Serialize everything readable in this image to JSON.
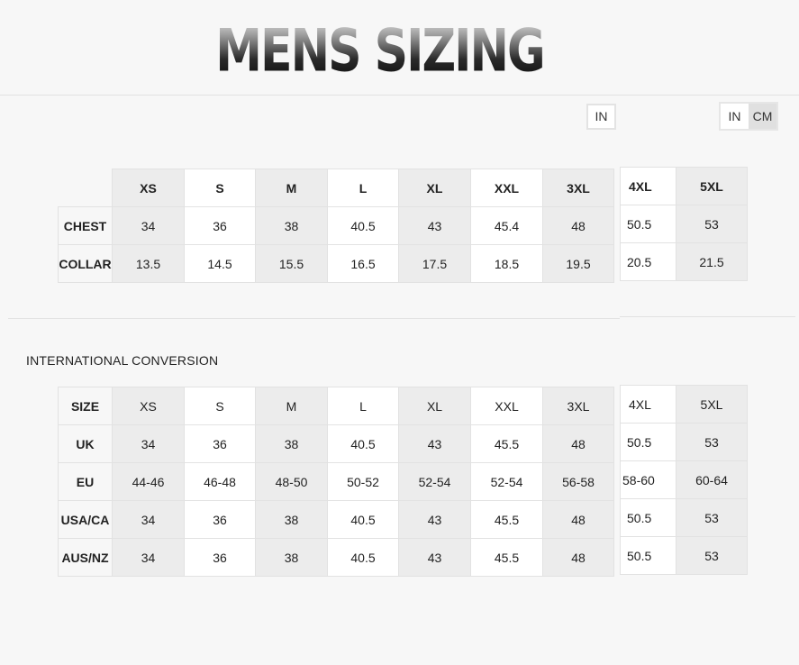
{
  "title": "MENS SIZING",
  "unit_toggle_single": "IN",
  "unit_toggle": {
    "in": "IN",
    "cm": "CM"
  },
  "section2_title": "INTERNATIONAL CONVERSION",
  "sizes_main": [
    "XS",
    "S",
    "M",
    "L",
    "XL",
    "XXL",
    "3XL"
  ],
  "sizes_extra": [
    "4XL",
    "5XL"
  ],
  "measurements": [
    {
      "label": "CHEST",
      "values": [
        "34",
        "36",
        "38",
        "40.5",
        "43",
        "45.4",
        "48"
      ],
      "extra": [
        "50.5",
        "53"
      ]
    },
    {
      "label": "COLLAR",
      "values": [
        "13.5",
        "14.5",
        "15.5",
        "16.5",
        "17.5",
        "18.5",
        "19.5"
      ],
      "extra": [
        "20.5",
        "21.5"
      ]
    }
  ],
  "conversion": {
    "header_label": "SIZE",
    "rows": [
      {
        "label": "UK",
        "values": [
          "34",
          "36",
          "38",
          "40.5",
          "43",
          "45.5",
          "48"
        ],
        "extra": [
          "50.5",
          "53"
        ]
      },
      {
        "label": "EU",
        "values": [
          "44-46",
          "46-48",
          "48-50",
          "50-52",
          "52-54",
          "52-54",
          "56-58"
        ],
        "extra": [
          "58-60",
          "60-64"
        ]
      },
      {
        "label": "USA/CA",
        "values": [
          "34",
          "36",
          "38",
          "40.5",
          "43",
          "45.5",
          "48"
        ],
        "extra": [
          "50.5",
          "53"
        ]
      },
      {
        "label": "AUS/NZ",
        "values": [
          "34",
          "36",
          "38",
          "40.5",
          "43",
          "45.5",
          "48"
        ],
        "extra": [
          "50.5",
          "53"
        ]
      }
    ]
  }
}
